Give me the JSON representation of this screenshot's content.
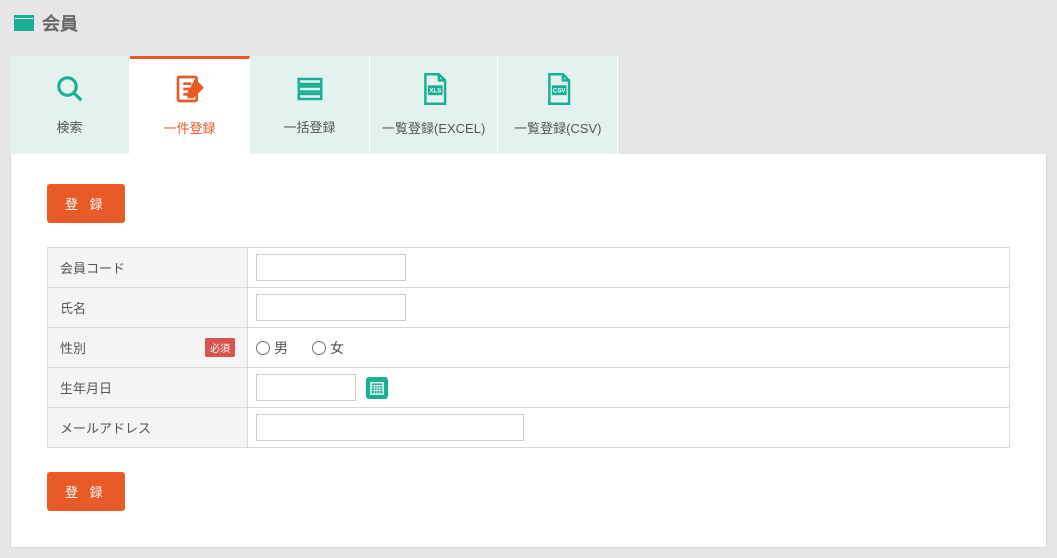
{
  "header": {
    "title": "会員"
  },
  "tabs": {
    "search": "検索",
    "single": "一件登録",
    "bulk": "一括登録",
    "list_excel": "一覧登録(EXCEL)",
    "list_csv": "一覧登録(CSV)"
  },
  "buttons": {
    "register": "登 録"
  },
  "form": {
    "member_code": {
      "label": "会員コード"
    },
    "name": {
      "label": "氏名"
    },
    "gender": {
      "label": "性別",
      "required": "必須",
      "male": "男",
      "female": "女"
    },
    "birthdate": {
      "label": "生年月日"
    },
    "email": {
      "label": "メールアドレス"
    }
  }
}
